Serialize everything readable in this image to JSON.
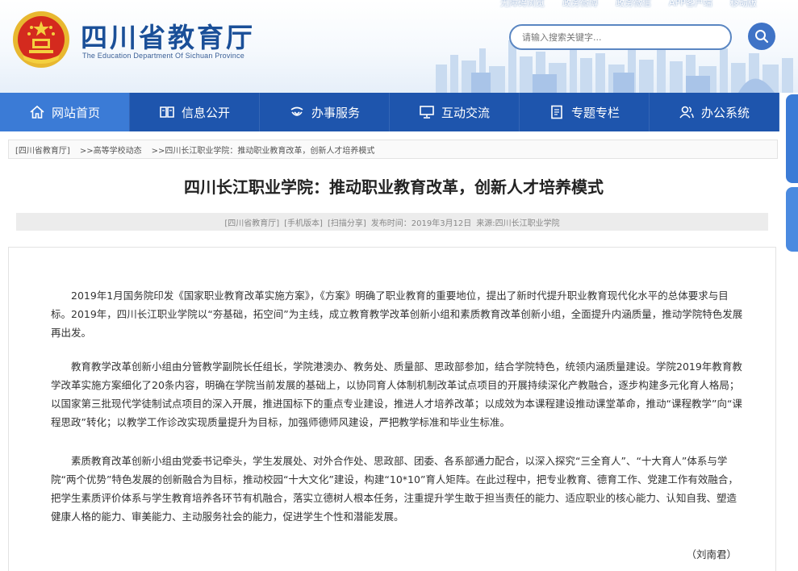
{
  "header": {
    "logo_cn": "四川省教育厅",
    "logo_en": "The Education Department Of Sichuan Province",
    "top_links": [
      "无障碍浏览",
      "政务微博",
      "政务微信",
      "APP客户端",
      "移动版"
    ],
    "search_placeholder": "请输入搜索关键字..."
  },
  "nav": {
    "items": [
      {
        "label": "网站首页",
        "icon": "home-icon"
      },
      {
        "label": "信息公开",
        "icon": "book-icon"
      },
      {
        "label": "办事服务",
        "icon": "hands-icon"
      },
      {
        "label": "互动交流",
        "icon": "monitor-icon"
      },
      {
        "label": "专题专栏",
        "icon": "document-icon"
      },
      {
        "label": "办公系统",
        "icon": "users-icon"
      }
    ]
  },
  "breadcrumb": [
    "[四川省教育厅]",
    ">>高等学校动态",
    ">>四川长江职业学院：推动职业教育改革，创新人才培养模式"
  ],
  "article": {
    "title": "四川长江职业学院：推动职业教育改革，创新人才培养模式",
    "meta": [
      "[四川省教育厅]",
      "[手机版本]",
      "[扫描分享]",
      "发布时间：2019年3月12日",
      "来源:四川长江职业学院"
    ],
    "paragraphs": [
      "2019年1月国务院印发《国家职业教育改革实施方案》，《方案》明确了职业教育的重要地位，提出了新时代提升职业教育现代化水平的总体要求与目标。2019年，四川长江职业学院以“夯基础，拓空间”为主线，成立教育教学改革创新小组和素质教育改革创新小组，全面提升内涵质量，推动学院特色发展再出发。",
      "教育教学改革创新小组由分管教学副院长任组长，学院港澳办、教务处、质量部、思政部参加，结合学院特色，统领内涵质量建设。学院2019年教育教学改革实施方案细化了20条内容，明确在学院当前发展的基础上，以协同育人体制机制改革试点项目的开展持续深化产教融合，逐步构建多元化育人格局；以国家第三批现代学徒制试点项目的深入开展，推进国标下的重点专业建设，推进人才培养改革；以成效为本课程建设推动课堂革命，推动“课程教学”向“课程思政”转化；以教学工作诊改实现质量提升为目标，加强师德师风建设，严把教学标准和毕业生标准。",
      "素质教育改革创新小组由党委书记牵头，学生发展处、对外合作处、思政部、团委、各系部通力配合，以深入探究“三全育人”、“十大育人”体系与学院“两个优势”特色发展的创新融合为目标，推动校园“十大文化”建设，构建“10*10”育人矩阵。在此过程中，把专业教育、德育工作、党建工作有效融合，把学生素质评价体系与学生教育培养各环节有机融合，落实立德树人根本任务，注重提升学生敢于担当责任的能力、适应职业的核心能力、认知自我、塑造健康人格的能力、审美能力、主动服务社会的能力，促进学生个性和潜能发展。"
    ],
    "author": "（刘南君）"
  },
  "colors": {
    "nav_bg": "#1e55ad",
    "nav_active": "#3b7bd6",
    "logo_blue": "#1a4f98"
  }
}
